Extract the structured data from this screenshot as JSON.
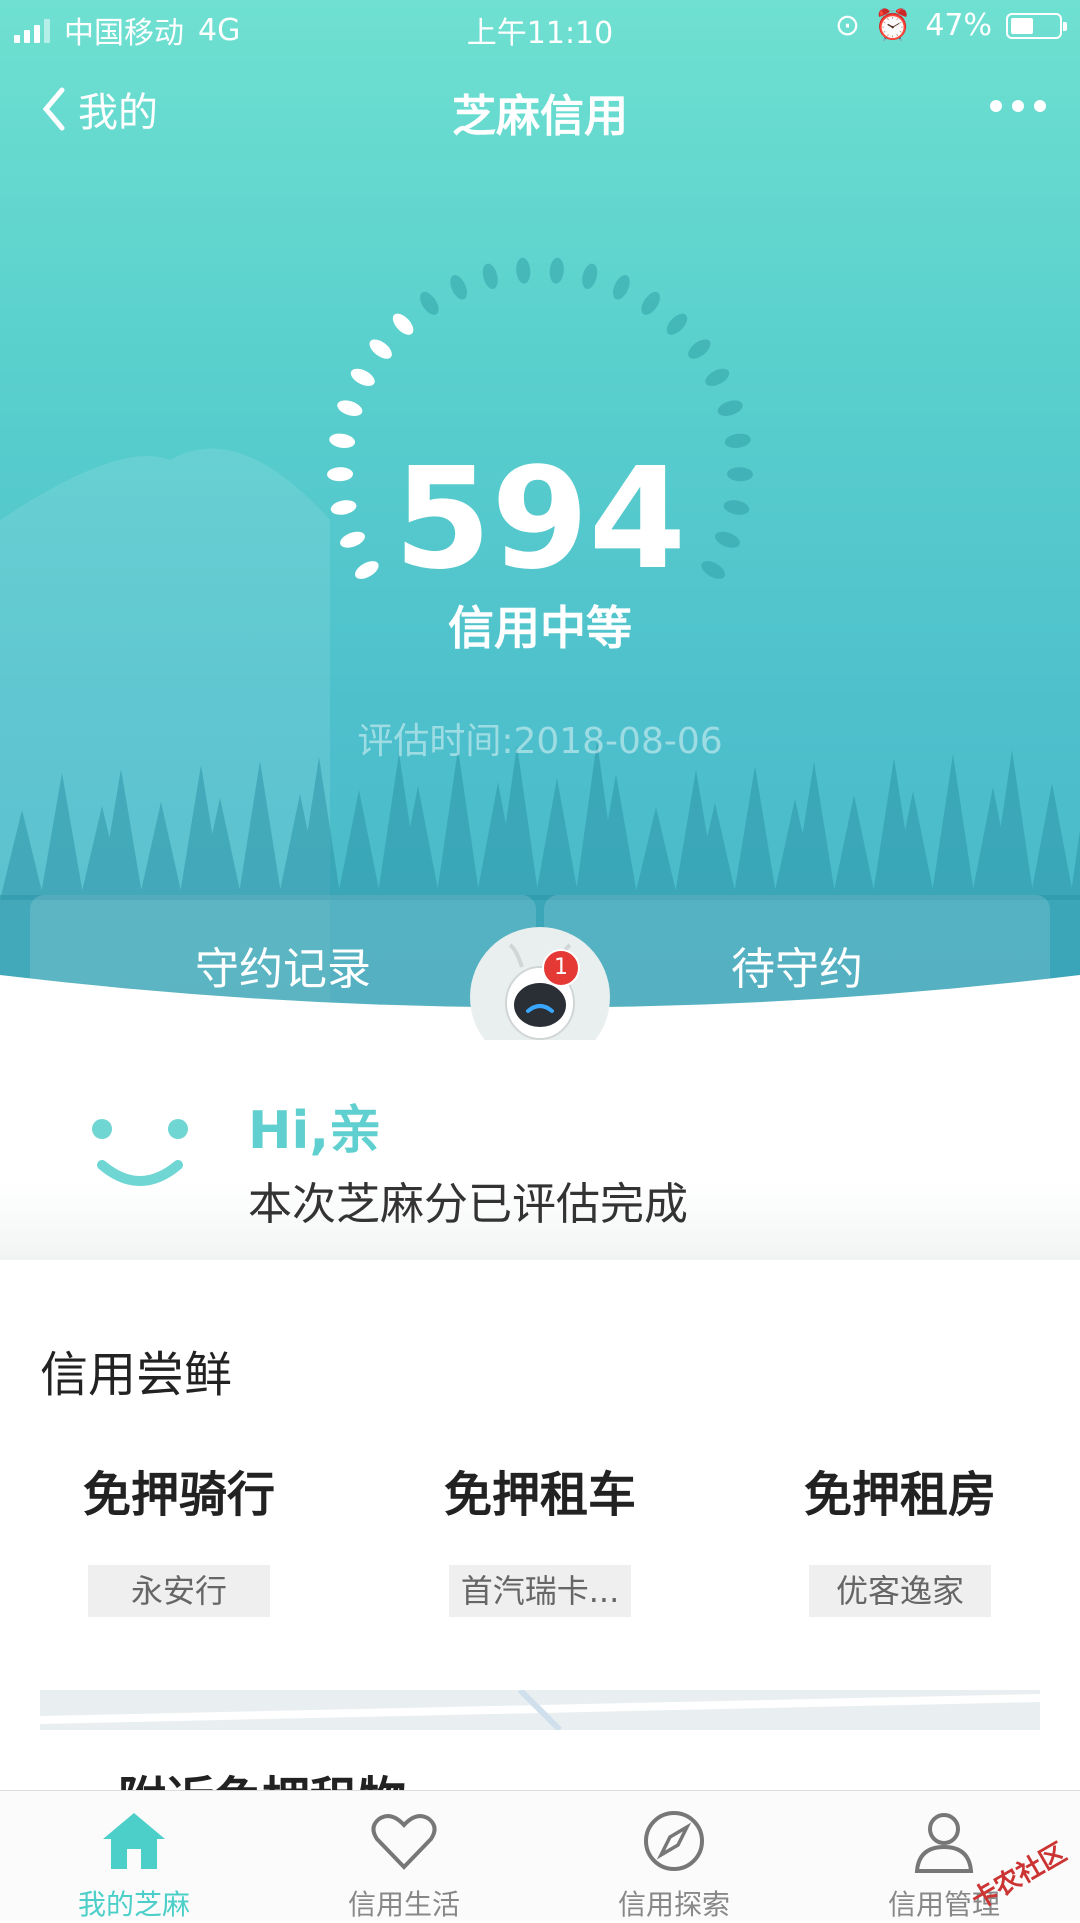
{
  "status_bar": {
    "carrier": "中国移动",
    "network": "4G",
    "time": "上午11:10",
    "battery": "47%",
    "battery_level": 0.47
  },
  "nav": {
    "back_label": "我的",
    "title": "芝麻信用"
  },
  "score": {
    "value": "594",
    "level": "信用中等",
    "eval_time": "评估时间:2018-08-06"
  },
  "tabs": {
    "left": "守约记录",
    "right": "待守约",
    "robot_badge": "1"
  },
  "greeting": {
    "hi": "Hi,亲",
    "message": "本次芝麻分已评估完成"
  },
  "section": {
    "title": "信用尝鲜",
    "items": [
      {
        "name": "免押骑行",
        "tag": "永安行"
      },
      {
        "name": "免押租车",
        "tag": "首汽瑞卡..."
      },
      {
        "name": "免押租房",
        "tag": "优客逸家"
      }
    ]
  },
  "map_card": {
    "title": "附近免押租物"
  },
  "tab_bar": [
    {
      "label": "我的芝麻",
      "icon": "home-icon",
      "active": true
    },
    {
      "label": "信用生活",
      "icon": "heart-icon",
      "active": false
    },
    {
      "label": "信用探索",
      "icon": "compass-icon",
      "active": false
    },
    {
      "label": "信用管理",
      "icon": "person-icon",
      "active": false
    }
  ],
  "watermark": "卡农社区",
  "colors": {
    "accent": "#4ccfc9",
    "hero_top": "#6fe0d1",
    "hero_bottom": "#49b8c8",
    "badge": "#e53935"
  }
}
